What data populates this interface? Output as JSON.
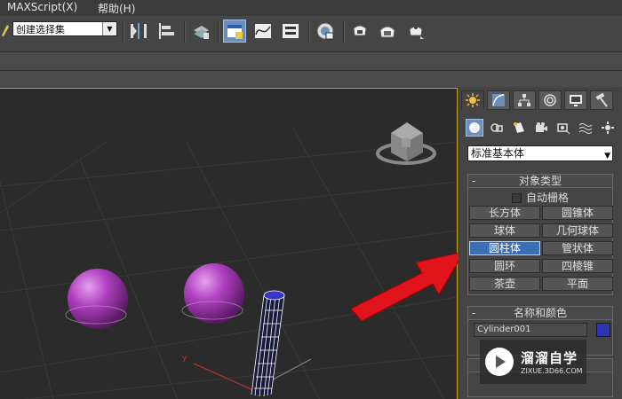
{
  "menubar": {
    "items": [
      "MAXScript(X)",
      "帮助(H)"
    ]
  },
  "toolbar": {
    "selection_set": "创建选择集",
    "icons": [
      "mirror-icon",
      "align-icon",
      "layer-manager-icon",
      "scene-explorer-icon",
      "curve-editor-icon",
      "schematic-view-icon",
      "material-editor-icon",
      "render-setup-icon",
      "rendered-frame-icon",
      "render-icon"
    ]
  },
  "command_panel": {
    "tabs": [
      "create-tab",
      "modify-tab",
      "hierarchy-tab",
      "motion-tab",
      "display-tab",
      "utilities-tab"
    ],
    "subcategories": [
      "geometry-icon",
      "shapes-icon",
      "lights-icon",
      "cameras-icon",
      "helpers-icon",
      "space-warps-icon",
      "systems-icon"
    ],
    "category_dropdown": "标准基本体",
    "object_type": {
      "title": "对象类型",
      "collapse": "-",
      "autogrid": "自动栅格",
      "buttons": [
        "长方体",
        "圆锥体",
        "球体",
        "几何球体",
        "圆柱体",
        "管状体",
        "圆环",
        "四棱锥",
        "茶壶",
        "平面"
      ],
      "active": "圆柱体"
    },
    "name_color": {
      "title": "名称和颜色",
      "collapse": "-",
      "name_value": "Cylinder001",
      "color": "#2d35b0"
    }
  },
  "watermark": {
    "title": "溜溜自学",
    "subtitle": "ZIXUE.3D66.COM"
  },
  "colors": {
    "active_viewport_border": "#c9a326",
    "sphere": "#b040c0",
    "arrow": "#e0141a"
  }
}
